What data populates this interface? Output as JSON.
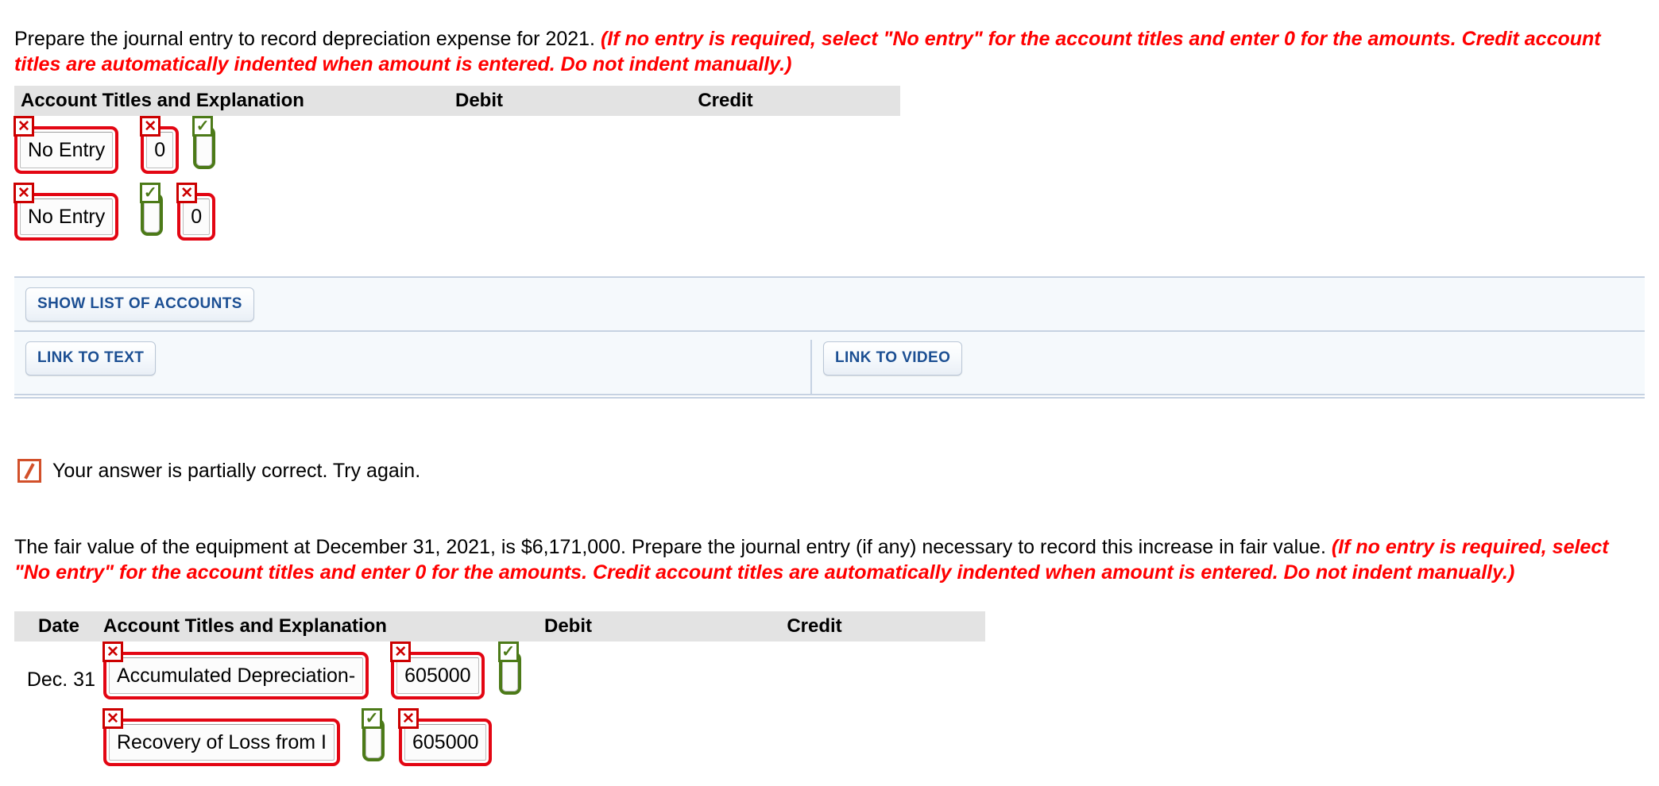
{
  "section1": {
    "prompt_main": "Prepare the journal entry to record depreciation expense for 2021.",
    "prompt_hint": "(If no entry is required, select \"No entry\" for the account titles and enter 0 for the amounts. Credit account titles are automatically indented when amount is entered. Do not indent manually.)",
    "table": {
      "headers": {
        "account": "Account Titles and Explanation",
        "debit": "Debit",
        "credit": "Credit"
      },
      "rows": [
        {
          "account": {
            "value": "No Entry",
            "status": "incorrect",
            "flag": "✕",
            "align": "left"
          },
          "debit": {
            "value": "0",
            "status": "incorrect",
            "flag": "✕",
            "align": "right"
          },
          "credit": {
            "value": "",
            "status": "correct",
            "flag": "✓",
            "align": "right"
          }
        },
        {
          "account": {
            "value": "No Entry",
            "status": "incorrect",
            "flag": "✕",
            "align": "center"
          },
          "debit": {
            "value": "",
            "status": "correct",
            "flag": "✓",
            "align": "right"
          },
          "credit": {
            "value": "0",
            "status": "incorrect",
            "flag": "✕",
            "align": "right"
          }
        }
      ]
    },
    "buttons": {
      "show_list": "SHOW LIST OF ACCOUNTS",
      "link_text": "LINK TO TEXT",
      "link_video": "LINK TO VIDEO"
    }
  },
  "section2": {
    "feedback": "Your answer is partially correct.  Try again.",
    "feedback_icon": "partial-credit-icon",
    "prompt_main": "The fair value of the equipment at December 31, 2021, is $6,171,000. Prepare the journal entry (if any) necessary to record this increase in fair value.",
    "prompt_hint": "(If no entry is required, select \"No entry\" for the account titles and enter 0 for the amounts. Credit account titles are automatically indented when amount is entered. Do not indent manually.)",
    "table": {
      "headers": {
        "date": "Date",
        "account": "Account Titles and Explanation",
        "debit": "Debit",
        "credit": "Credit"
      },
      "rows": [
        {
          "date": "Dec. 31",
          "account": {
            "value": "Accumulated Depreciation-",
            "status": "incorrect",
            "flag": "✕",
            "align": "left"
          },
          "debit": {
            "value": "605000",
            "status": "incorrect",
            "flag": "✕",
            "align": "right"
          },
          "credit": {
            "value": "",
            "status": "correct",
            "flag": "✓",
            "align": "right"
          }
        },
        {
          "date": "",
          "account": {
            "value": "Recovery of Loss from I",
            "status": "incorrect",
            "flag": "✕",
            "align": "center"
          },
          "debit": {
            "value": "",
            "status": "correct",
            "flag": "✓",
            "align": "right"
          },
          "credit": {
            "value": "605000",
            "status": "incorrect",
            "flag": "✕",
            "align": "right"
          }
        }
      ]
    }
  },
  "colors": {
    "error": "#e30613",
    "success": "#4c7a18",
    "hint_text": "#ff0000",
    "header_bg": "#e3e3e3",
    "button_text": "#1c4f93",
    "panel_bg": "#f5f9fc",
    "partial_icon": "#d2502a"
  }
}
